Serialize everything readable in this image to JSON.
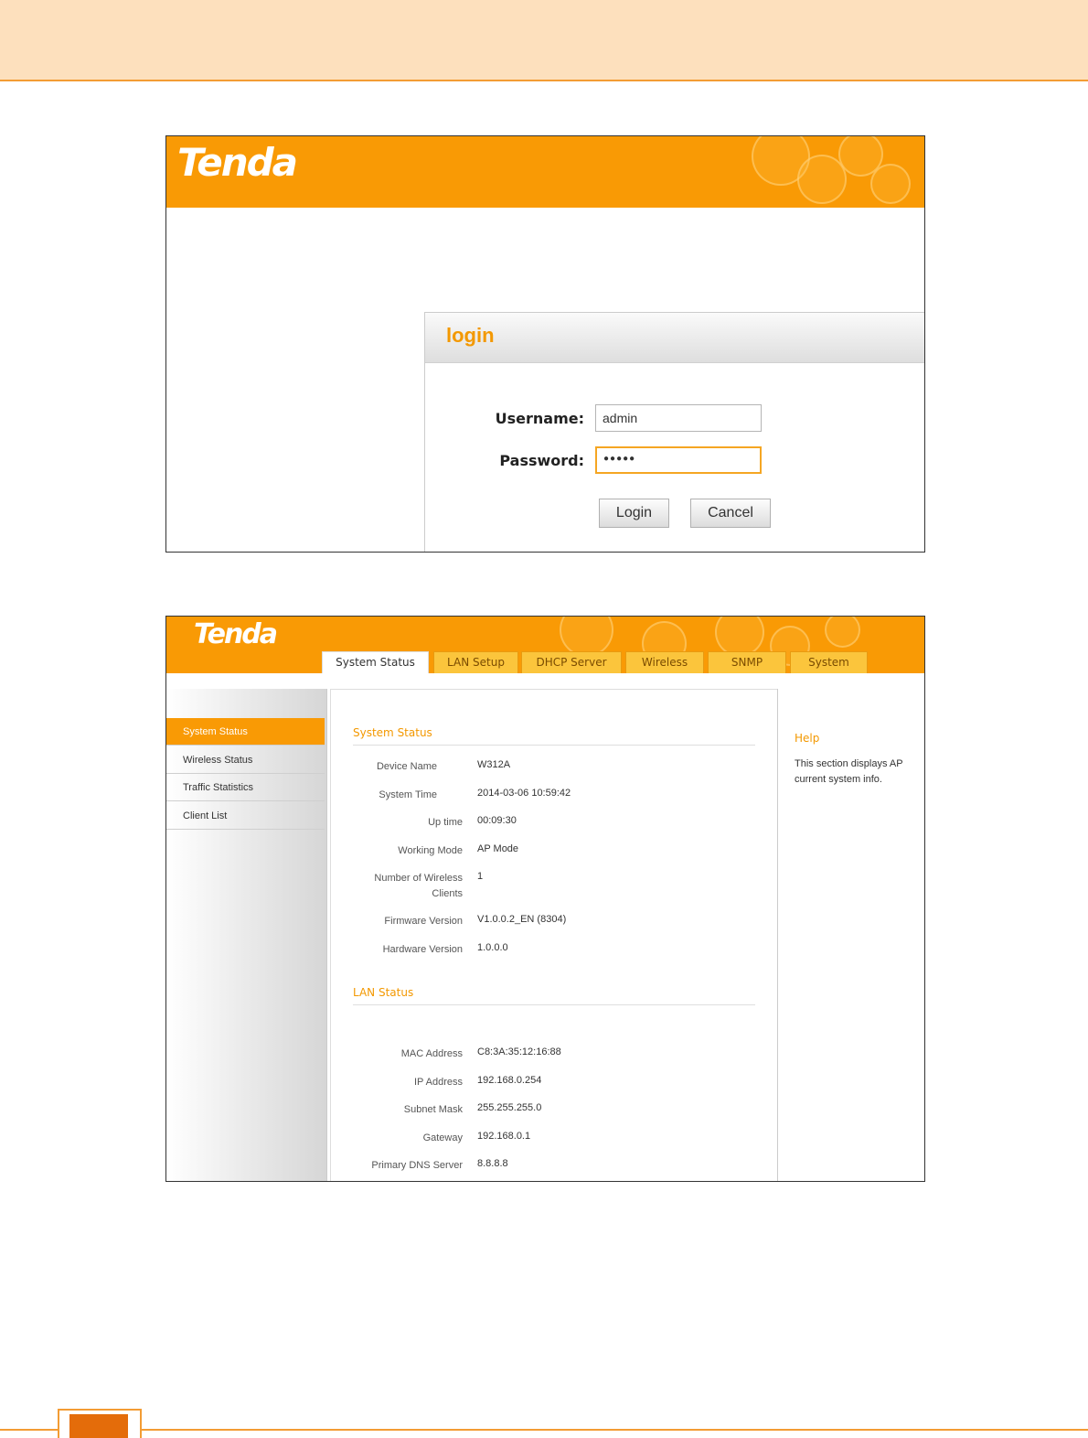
{
  "login_screen": {
    "logo": "Tenda",
    "title": "login",
    "username_label": "Username:",
    "username_value": "admin",
    "password_label": "Password:",
    "password_value": "●●●●●",
    "login_button": "Login",
    "cancel_button": "Cancel"
  },
  "status_screen": {
    "logo": "Tenda",
    "tabs": [
      {
        "label": "System Status"
      },
      {
        "label": "LAN Setup"
      },
      {
        "label": "DHCP Server"
      },
      {
        "label": "Wireless"
      },
      {
        "label": "SNMP"
      },
      {
        "label": "System"
      }
    ],
    "sidebar": [
      {
        "label": "System Status"
      },
      {
        "label": "Wireless Status"
      },
      {
        "label": "Traffic Statistics"
      },
      {
        "label": "Client List"
      }
    ],
    "system_status": {
      "title": "System Status",
      "rows": [
        {
          "label": "Device Name",
          "value": "W312A"
        },
        {
          "label": "System Time",
          "value": "2014-03-06 10:59:42"
        },
        {
          "label": "Up time",
          "value": "00:09:30"
        },
        {
          "label": "Working Mode",
          "value": "AP Mode"
        },
        {
          "label": "Number of Wireless Clients",
          "value": "1"
        },
        {
          "label": "Firmware Version",
          "value": "V1.0.0.2_EN (8304)"
        },
        {
          "label": "Hardware Version",
          "value": "1.0.0.0"
        }
      ]
    },
    "lan_status": {
      "title": "LAN Status",
      "rows": [
        {
          "label": "MAC Address",
          "value": "C8:3A:35:12:16:88"
        },
        {
          "label": "IP Address",
          "value": "192.168.0.254"
        },
        {
          "label": "Subnet Mask",
          "value": "255.255.255.0"
        },
        {
          "label": "Gateway",
          "value": "192.168.0.1"
        },
        {
          "label": "Primary DNS Server",
          "value": "8.8.8.8"
        }
      ]
    },
    "help": {
      "title": "Help",
      "text": "This section displays AP current system info."
    }
  },
  "colors": {
    "brand_orange": "#f99a05",
    "accent_text": "#f39800",
    "band": "#fde0bd",
    "footer_block": "#e46c0a"
  }
}
